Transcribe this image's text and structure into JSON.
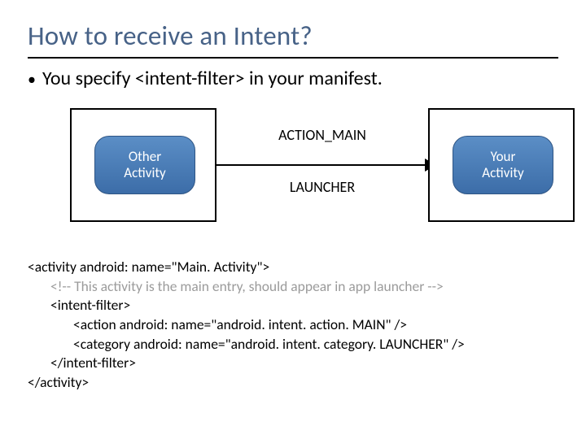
{
  "title": "How to receive an Intent?",
  "bullet": "You specify <intent-filter> in your manifest.",
  "diagram": {
    "left_box": "Other\nActivity",
    "right_box": "Your\nActivity",
    "arrow_top": "ACTION_MAIN",
    "arrow_bottom": "LAUNCHER"
  },
  "code": {
    "l1": "<activity android: name=\"Main. Activity\">",
    "l2": "<!-- This activity is the main entry, should appear in app launcher -->",
    "l3": "<intent-filter>",
    "l4": "<action android: name=\"android. intent. action. MAIN\" />",
    "l5": "<category android: name=\"android. intent. category. LAUNCHER\" />",
    "l6": "</intent-filter>",
    "l7": "</activity>"
  }
}
